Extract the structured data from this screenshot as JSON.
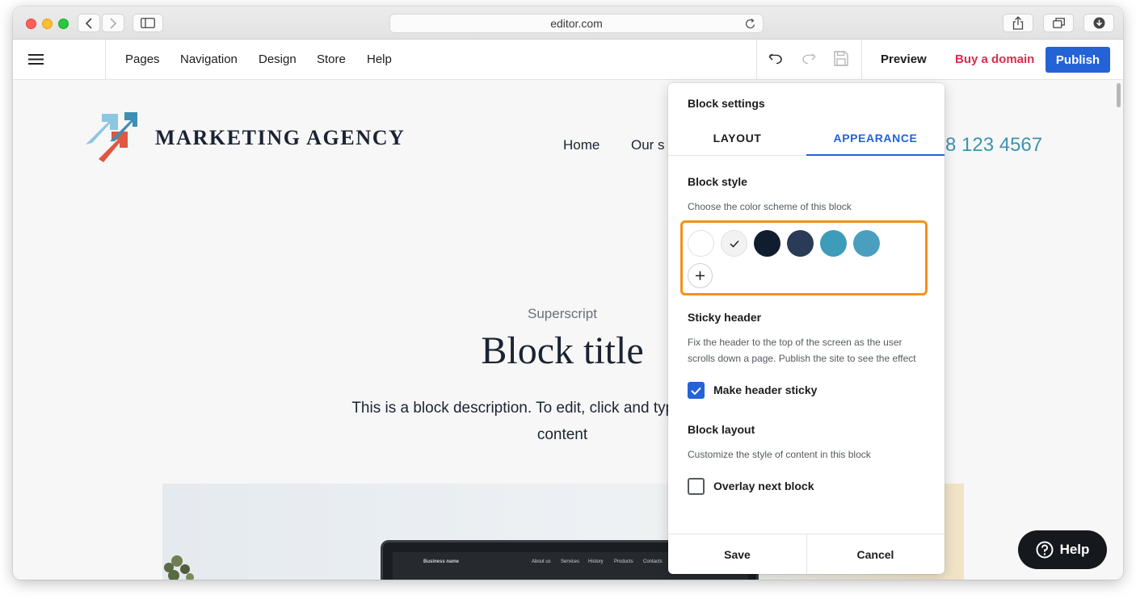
{
  "browser": {
    "url": "editor.com"
  },
  "toolbar": {
    "menu": [
      "Pages",
      "Navigation",
      "Design",
      "Store",
      "Help"
    ],
    "preview_label": "Preview",
    "buy_domain_label": "Buy a domain",
    "publish_label": "Publish"
  },
  "site": {
    "brand": "MARKETING AGENCY",
    "nav": [
      "Home",
      "Our s"
    ],
    "phone": "8 123 4567",
    "superscript": "Superscript",
    "block_title": "Block title",
    "block_description_line1": "This is a block description. To edit, click and type the text or re",
    "block_description_line2": "content",
    "laptop_nav": {
      "brand": "Business name",
      "links": [
        "About us",
        "Services",
        "History",
        "Products",
        "Contacts"
      ]
    }
  },
  "panel": {
    "title": "Block settings",
    "tabs": [
      {
        "label": "LAYOUT",
        "active": false
      },
      {
        "label": "APPEARANCE",
        "active": true
      }
    ],
    "block_style": {
      "title": "Block style",
      "description": "Choose the color scheme of this block",
      "swatches": [
        "#ffffff",
        "#f2f2f2",
        "#0f1d2e",
        "#2a3a57",
        "#3e9cbb",
        "#4a9fbf"
      ],
      "selected_index": 1
    },
    "sticky_header": {
      "title": "Sticky header",
      "description_line1": "Fix the header to the top of the screen as the user",
      "description_line2": "scrolls down a page. Publish the site to see the effect",
      "checkbox_label": "Make header sticky",
      "checked": true
    },
    "block_layout": {
      "title": "Block layout",
      "description": "Customize the style of content in this block",
      "checkbox_label": "Overlay next block",
      "checked": false
    },
    "save_label": "Save",
    "cancel_label": "Cancel"
  },
  "help_label": "Help",
  "colors": {
    "accent": "#2463d6",
    "buy_domain": "#d92d4c",
    "highlight_border": "#f39217",
    "phone": "#3e94ad"
  }
}
